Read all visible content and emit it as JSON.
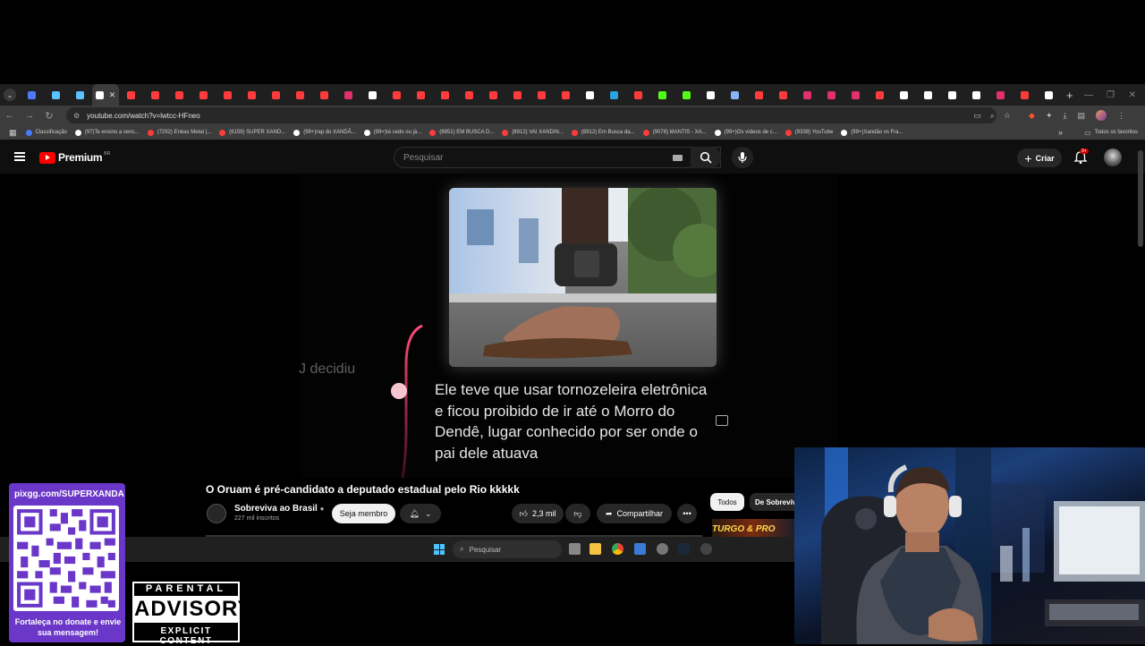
{
  "browser": {
    "url": "youtube.com/watch?v=lwtcc-HFneo",
    "tab_close": "✕",
    "new_tab": "+",
    "tab_favicon_colors": [
      "#4a7bff",
      "#59c2ff",
      "#59c2ff",
      "#ffffff",
      "#ff3b3b",
      "#ff3b3b",
      "#ff3b3b",
      "#ff3b3b",
      "#ff3b3b",
      "#ff3b3b",
      "#ff3b3b",
      "#ff3b3b",
      "#ff3b3b",
      "#e1306c",
      "#ffffff",
      "#ff3b3b",
      "#ff3b3b",
      "#ff3b3b",
      "#ff3b3b",
      "#ff3b3b",
      "#ff3b3b",
      "#ff3b3b",
      "#ff3b3b",
      "#ffffff",
      "#2aa3e0",
      "#ff3b3b",
      "#53fc18",
      "#53fc18",
      "#ffffff",
      "#8ab4f8",
      "#ff3b3b",
      "#ff3b3b",
      "#e1306c",
      "#e1306c",
      "#e1306c",
      "#ff3b3b",
      "#ffffff",
      "#ffffff",
      "#ffffff",
      "#ffffff",
      "#e1306c",
      "#ff3b3b",
      "#ffffff"
    ],
    "bookmarks": [
      {
        "label": "Classificação",
        "color": "#4a7bff"
      },
      {
        "label": "(97)Te ensino a venc...",
        "color": "#ffffff"
      },
      {
        "label": "(7292) Enéas Metal |...",
        "color": "#ff3b3b"
      },
      {
        "label": "(8159) SUPER XAND...",
        "color": "#ff3b3b"
      },
      {
        "label": "(99+)rap do XANDÃ...",
        "color": "#ffffff"
      },
      {
        "label": "(99+)tá cedo ou já...",
        "color": "#ffffff"
      },
      {
        "label": "(8851) EM BUSCA D...",
        "color": "#ff3b3b"
      },
      {
        "label": "(8912) VAI XANDIN...",
        "color": "#ff3b3b"
      },
      {
        "label": "(8912) Em Busca da...",
        "color": "#ff3b3b"
      },
      {
        "label": "(9078) MANTIS - XA...",
        "color": "#ff3b3b"
      },
      {
        "label": "(99+)Os vídeos de c...",
        "color": "#ffffff"
      },
      {
        "label": "(9338) YouTube",
        "color": "#ff3b3b"
      },
      {
        "label": "(99+)Xandão vs Fra...",
        "color": "#ffffff"
      }
    ],
    "all_favorites": "Todos os favoritos"
  },
  "youtube": {
    "logo_text": "Premium",
    "logo_region": "BR",
    "search_placeholder": "Pesquisar",
    "create_label": "Criar",
    "notif_badge": "9+",
    "accent": "#ff0000"
  },
  "video": {
    "left_fragment": "J decidiu",
    "caption": "Ele teve que usar tornozeleira eletrônica e ficou proibido de ir até o Morro do Dendê, lugar conhecido por ser onde o pai dele atuava",
    "title": "O Oruam é pré-candidato a deputado estadual pelo Rio kkkkk",
    "channel_name": "Sobreviva ao Brasil",
    "subscribers": "227 mil inscritos",
    "member_button": "Seja membro",
    "likes": "2,3 mil",
    "share": "Compartilhar",
    "more": "•••"
  },
  "chips": {
    "all": "Todos",
    "from": "De Sobreviva"
  },
  "thumb_text": "TURGO & PRO",
  "taskbar": {
    "search": "Pesquisar"
  },
  "overlay": {
    "donate_url": "pixgg.com/SUPERXANDA",
    "donate_message": "Fortaleça no donate e envie sua mensagem!",
    "advisory_top": "PARENTAL",
    "advisory_mid": "ADVISORY",
    "advisory_bottom": "EXPLICIT CONTENT"
  }
}
